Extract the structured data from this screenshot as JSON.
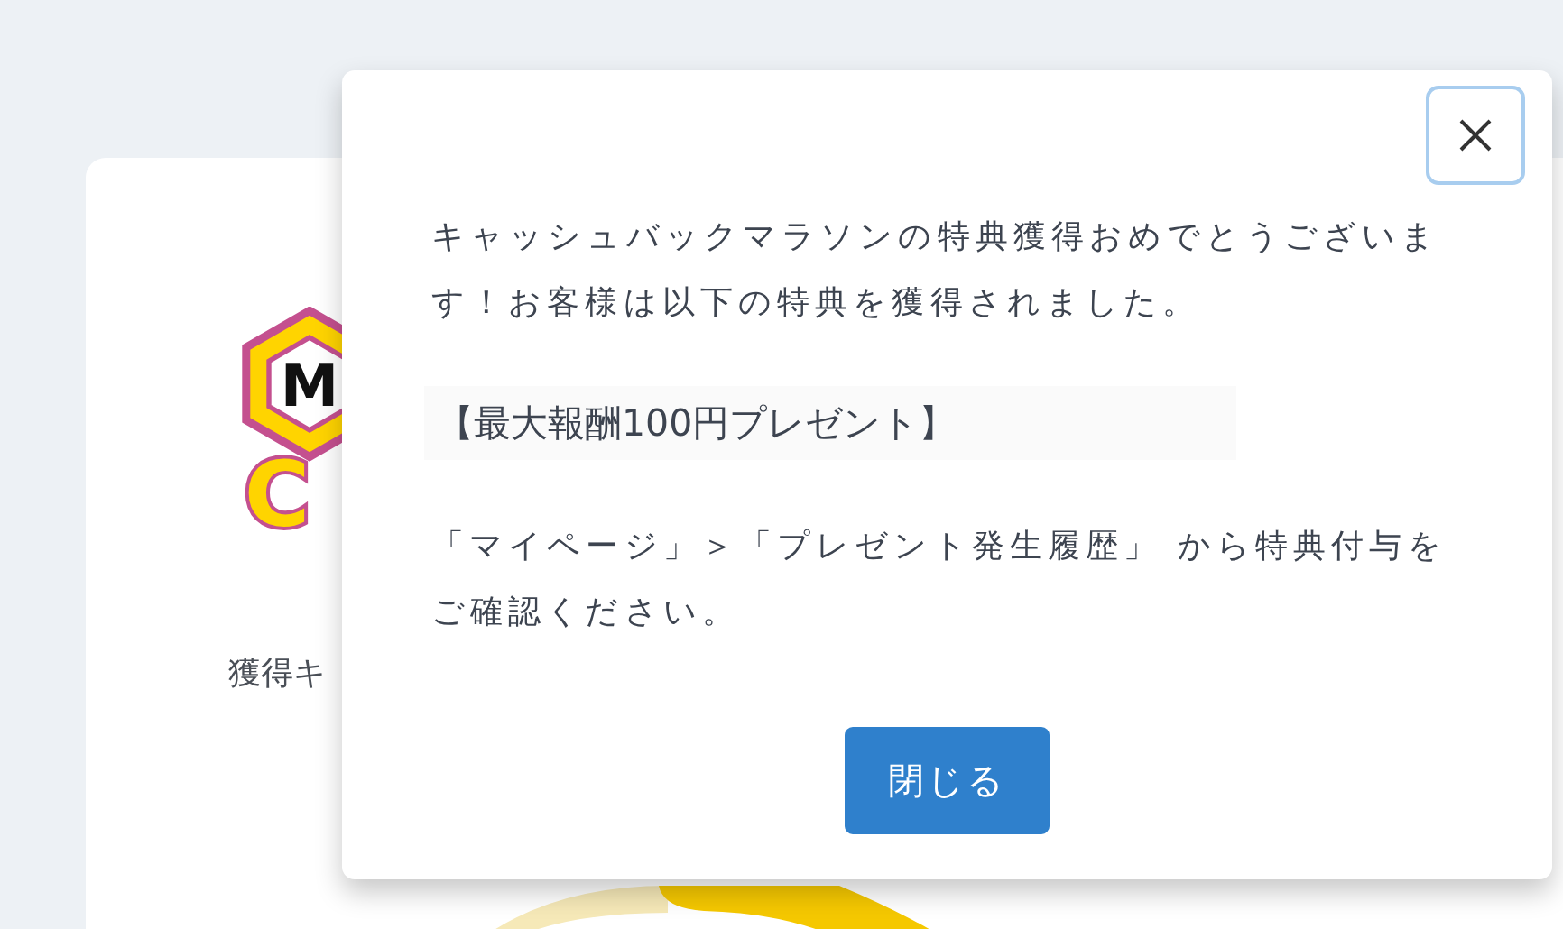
{
  "background_card": {
    "logo": {
      "mark_letter": "M",
      "word_letter": "C"
    },
    "label": "獲得キ"
  },
  "dialog": {
    "message": "キャッシュバックマラソンの特典獲得おめでとうございます！お客様は以下の特典を獲得されました。",
    "reward": "【最大報酬100円プレゼント】",
    "instruction": "「マイページ」＞「プレゼント発生履歴」 から特典付与をご確認ください。",
    "close_button": "閉じる"
  }
}
